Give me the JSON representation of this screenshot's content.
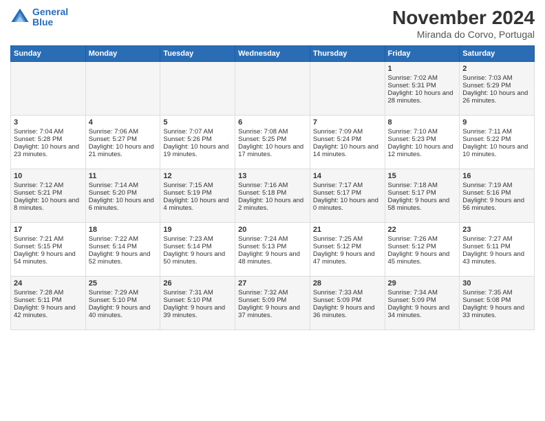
{
  "logo": {
    "line1": "General",
    "line2": "Blue"
  },
  "title": "November 2024",
  "location": "Miranda do Corvo, Portugal",
  "days_header": [
    "Sunday",
    "Monday",
    "Tuesday",
    "Wednesday",
    "Thursday",
    "Friday",
    "Saturday"
  ],
  "weeks": [
    [
      {
        "day": "",
        "content": ""
      },
      {
        "day": "",
        "content": ""
      },
      {
        "day": "",
        "content": ""
      },
      {
        "day": "",
        "content": ""
      },
      {
        "day": "",
        "content": ""
      },
      {
        "day": "1",
        "content": "Sunrise: 7:02 AM\nSunset: 5:31 PM\nDaylight: 10 hours and 28 minutes."
      },
      {
        "day": "2",
        "content": "Sunrise: 7:03 AM\nSunset: 5:29 PM\nDaylight: 10 hours and 26 minutes."
      }
    ],
    [
      {
        "day": "3",
        "content": "Sunrise: 7:04 AM\nSunset: 5:28 PM\nDaylight: 10 hours and 23 minutes."
      },
      {
        "day": "4",
        "content": "Sunrise: 7:06 AM\nSunset: 5:27 PM\nDaylight: 10 hours and 21 minutes."
      },
      {
        "day": "5",
        "content": "Sunrise: 7:07 AM\nSunset: 5:26 PM\nDaylight: 10 hours and 19 minutes."
      },
      {
        "day": "6",
        "content": "Sunrise: 7:08 AM\nSunset: 5:25 PM\nDaylight: 10 hours and 17 minutes."
      },
      {
        "day": "7",
        "content": "Sunrise: 7:09 AM\nSunset: 5:24 PM\nDaylight: 10 hours and 14 minutes."
      },
      {
        "day": "8",
        "content": "Sunrise: 7:10 AM\nSunset: 5:23 PM\nDaylight: 10 hours and 12 minutes."
      },
      {
        "day": "9",
        "content": "Sunrise: 7:11 AM\nSunset: 5:22 PM\nDaylight: 10 hours and 10 minutes."
      }
    ],
    [
      {
        "day": "10",
        "content": "Sunrise: 7:12 AM\nSunset: 5:21 PM\nDaylight: 10 hours and 8 minutes."
      },
      {
        "day": "11",
        "content": "Sunrise: 7:14 AM\nSunset: 5:20 PM\nDaylight: 10 hours and 6 minutes."
      },
      {
        "day": "12",
        "content": "Sunrise: 7:15 AM\nSunset: 5:19 PM\nDaylight: 10 hours and 4 minutes."
      },
      {
        "day": "13",
        "content": "Sunrise: 7:16 AM\nSunset: 5:18 PM\nDaylight: 10 hours and 2 minutes."
      },
      {
        "day": "14",
        "content": "Sunrise: 7:17 AM\nSunset: 5:17 PM\nDaylight: 10 hours and 0 minutes."
      },
      {
        "day": "15",
        "content": "Sunrise: 7:18 AM\nSunset: 5:17 PM\nDaylight: 9 hours and 58 minutes."
      },
      {
        "day": "16",
        "content": "Sunrise: 7:19 AM\nSunset: 5:16 PM\nDaylight: 9 hours and 56 minutes."
      }
    ],
    [
      {
        "day": "17",
        "content": "Sunrise: 7:21 AM\nSunset: 5:15 PM\nDaylight: 9 hours and 54 minutes."
      },
      {
        "day": "18",
        "content": "Sunrise: 7:22 AM\nSunset: 5:14 PM\nDaylight: 9 hours and 52 minutes."
      },
      {
        "day": "19",
        "content": "Sunrise: 7:23 AM\nSunset: 5:14 PM\nDaylight: 9 hours and 50 minutes."
      },
      {
        "day": "20",
        "content": "Sunrise: 7:24 AM\nSunset: 5:13 PM\nDaylight: 9 hours and 48 minutes."
      },
      {
        "day": "21",
        "content": "Sunrise: 7:25 AM\nSunset: 5:12 PM\nDaylight: 9 hours and 47 minutes."
      },
      {
        "day": "22",
        "content": "Sunrise: 7:26 AM\nSunset: 5:12 PM\nDaylight: 9 hours and 45 minutes."
      },
      {
        "day": "23",
        "content": "Sunrise: 7:27 AM\nSunset: 5:11 PM\nDaylight: 9 hours and 43 minutes."
      }
    ],
    [
      {
        "day": "24",
        "content": "Sunrise: 7:28 AM\nSunset: 5:11 PM\nDaylight: 9 hours and 42 minutes."
      },
      {
        "day": "25",
        "content": "Sunrise: 7:29 AM\nSunset: 5:10 PM\nDaylight: 9 hours and 40 minutes."
      },
      {
        "day": "26",
        "content": "Sunrise: 7:31 AM\nSunset: 5:10 PM\nDaylight: 9 hours and 39 minutes."
      },
      {
        "day": "27",
        "content": "Sunrise: 7:32 AM\nSunset: 5:09 PM\nDaylight: 9 hours and 37 minutes."
      },
      {
        "day": "28",
        "content": "Sunrise: 7:33 AM\nSunset: 5:09 PM\nDaylight: 9 hours and 36 minutes."
      },
      {
        "day": "29",
        "content": "Sunrise: 7:34 AM\nSunset: 5:09 PM\nDaylight: 9 hours and 34 minutes."
      },
      {
        "day": "30",
        "content": "Sunrise: 7:35 AM\nSunset: 5:08 PM\nDaylight: 9 hours and 33 minutes."
      }
    ]
  ]
}
